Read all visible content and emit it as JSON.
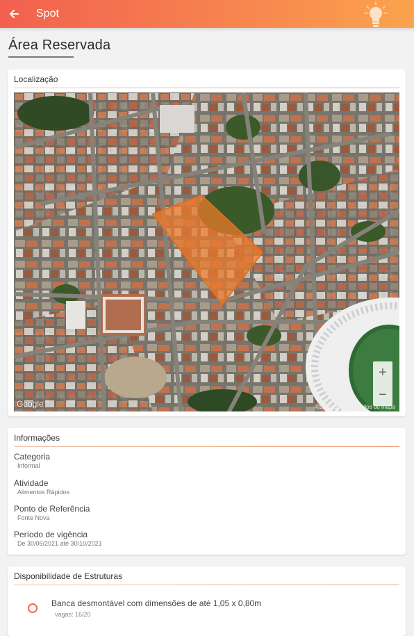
{
  "appbar": {
    "title": "Spot",
    "back_icon": "arrow-left-icon",
    "help_icon": "lightbulb-icon"
  },
  "page": {
    "title": "Área Reservada"
  },
  "location": {
    "title": "Localização",
    "map": {
      "attribution": "©2021 Google · Dados do mapa",
      "logo": "Google",
      "zoom_in": "+",
      "zoom_out": "−",
      "highlight_color": "#f07a2a"
    }
  },
  "info": {
    "title": "Informações",
    "rows": [
      {
        "label": "Categoria",
        "value": "Informal"
      },
      {
        "label": "Atividade",
        "value": "Alimentos Rápidos"
      },
      {
        "label": "Ponto de Referência",
        "value": "Fonte Nova"
      },
      {
        "label": "Período de vigência",
        "value": "De 30/06/2021 até 30/10/2021"
      }
    ]
  },
  "structures": {
    "title": "Disponibilidade de Estruturas",
    "items": [
      {
        "label": "Banca desmontável com dimensões de até 1,05 x 0,80m",
        "vagas": "vagas: 16/20"
      }
    ]
  }
}
